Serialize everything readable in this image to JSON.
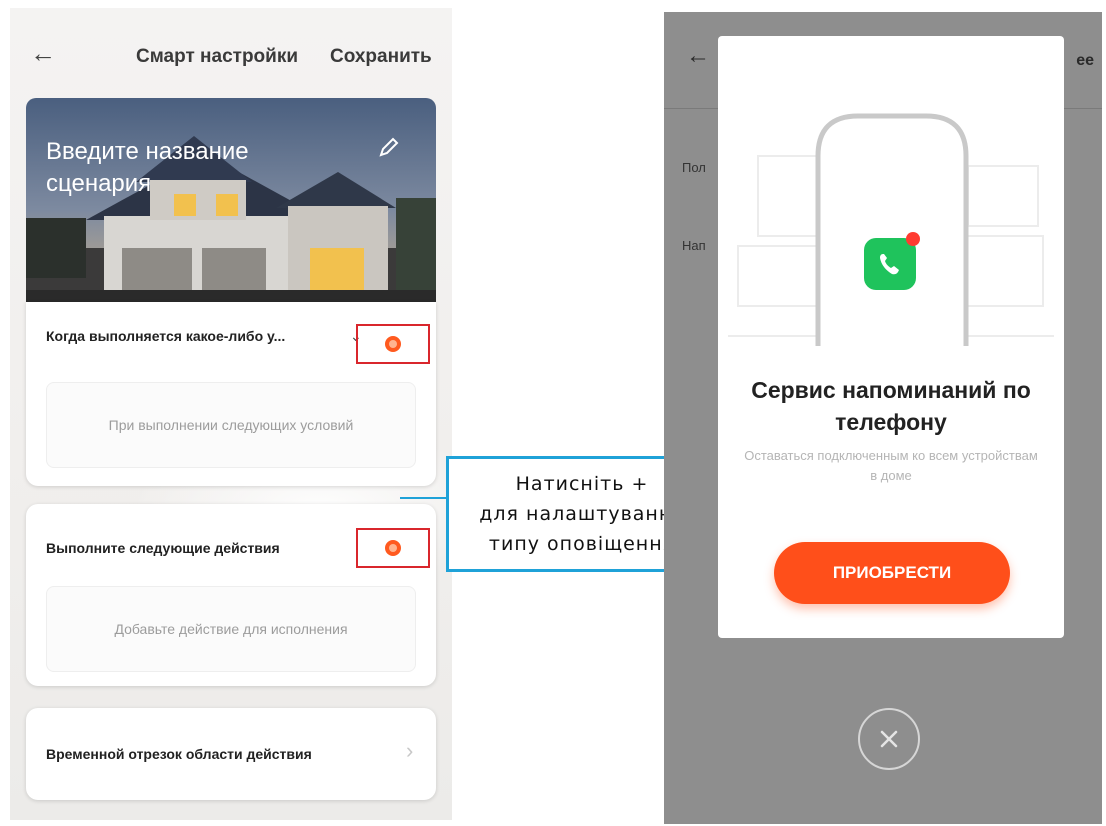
{
  "left_screen": {
    "back_icon": "back-arrow-icon",
    "title": "Смарт настройки",
    "save_label": "Сохранить",
    "hero_title": "Введите название сценария",
    "edit_icon": "pencil-icon",
    "condition": {
      "label": "Когда выполняется какое-либо у...",
      "placeholder": "При выполнении следующих условий"
    },
    "action": {
      "label": "Выполните следующие действия",
      "placeholder": "Добавьте действие для исполнения"
    },
    "time_range_label": "Временной отрезок области действия"
  },
  "callout": {
    "line1": "Натисніть +",
    "line2": "для налаштування",
    "line3": "типу оповіщення"
  },
  "right_screen": {
    "more_label": "ее",
    "partial_text_1": "Пол",
    "partial_text_2": "Нап",
    "modal": {
      "title": "Сервис напоминаний по телефону",
      "subtitle": "Оставаться подключенным ко всем устройствам в доме",
      "buy_label": "ПРИОБРЕСТИ",
      "app_icon": "phone-call-icon"
    },
    "close_icon": "close-icon"
  },
  "colors": {
    "accent_orange": "#ff4f1a",
    "highlight_red": "#d9262c",
    "callout_blue": "#1fa2d8",
    "app_green": "#1fc35c"
  }
}
